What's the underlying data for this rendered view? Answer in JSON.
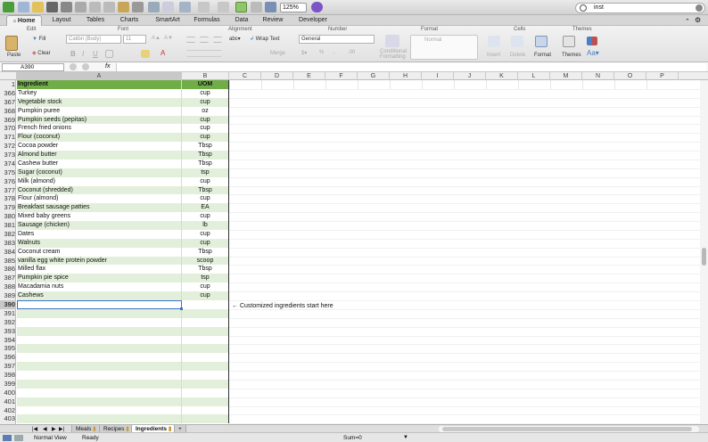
{
  "toolbar": {
    "zoom": "125%",
    "search_value": "inst"
  },
  "ribbon_tabs": [
    "Home",
    "Layout",
    "Tables",
    "Charts",
    "SmartArt",
    "Formulas",
    "Data",
    "Review",
    "Developer"
  ],
  "ribbon": {
    "groups": {
      "edit": "Edit",
      "font": "Font",
      "alignment": "Alignment",
      "number": "Number",
      "format": "Format",
      "cells": "Cells",
      "themes": "Themes"
    },
    "paste": "Paste",
    "fill": "Fill",
    "clear": "Clear",
    "font_name": "Calibri (Body)",
    "font_size": "11",
    "wrap_text": "Wrap Text",
    "merge": "Merge",
    "number_format": "General",
    "conditional_formatting": "Conditional Formatting",
    "style_normal": "Normal",
    "insert": "Insert",
    "delete": "Delete",
    "format_btn": "Format",
    "themes_btn": "Themes"
  },
  "formula_bar": {
    "cell_ref": "A390",
    "fx": "fx",
    "content": ""
  },
  "columns": [
    "A",
    "B",
    "C",
    "D",
    "E",
    "F",
    "G",
    "H",
    "I",
    "J",
    "K",
    "L",
    "M",
    "N",
    "O",
    "P"
  ],
  "header_row": {
    "num": "1",
    "ingredient": "Ingredient",
    "uom": "UOM"
  },
  "rows": [
    {
      "num": "366",
      "ingredient": "Turkey",
      "uom": "cup"
    },
    {
      "num": "367",
      "ingredient": "Vegetable stock",
      "uom": "cup"
    },
    {
      "num": "368",
      "ingredient": "Pumpkin puree",
      "uom": "oz"
    },
    {
      "num": "369",
      "ingredient": "Pumpkin seeds (pepitas)",
      "uom": "cup"
    },
    {
      "num": "370",
      "ingredient": "French fried onions",
      "uom": "cup"
    },
    {
      "num": "371",
      "ingredient": "Flour (coconut)",
      "uom": "cup"
    },
    {
      "num": "372",
      "ingredient": "Cocoa powder",
      "uom": "Tbsp"
    },
    {
      "num": "373",
      "ingredient": "Almond butter",
      "uom": "Tbsp"
    },
    {
      "num": "374",
      "ingredient": "Cashew butter",
      "uom": "Tbsp"
    },
    {
      "num": "375",
      "ingredient": "Sugar (coconut)",
      "uom": "tsp"
    },
    {
      "num": "376",
      "ingredient": "Milk (almond)",
      "uom": "cup"
    },
    {
      "num": "377",
      "ingredient": "Coconut (shredded)",
      "uom": "Tbsp"
    },
    {
      "num": "378",
      "ingredient": "Flour (almond)",
      "uom": "cup"
    },
    {
      "num": "379",
      "ingredient": "Breakfast sausage patties",
      "uom": "EA"
    },
    {
      "num": "380",
      "ingredient": "Mixed baby greens",
      "uom": "cup"
    },
    {
      "num": "381",
      "ingredient": "Sausage (chicken)",
      "uom": "lb"
    },
    {
      "num": "382",
      "ingredient": "Dates",
      "uom": "cup"
    },
    {
      "num": "383",
      "ingredient": "Walnuts",
      "uom": "cup"
    },
    {
      "num": "384",
      "ingredient": "Coconut cream",
      "uom": "Tbsp"
    },
    {
      "num": "385",
      "ingredient": "vanilla egg white protein powder",
      "uom": "scoop"
    },
    {
      "num": "386",
      "ingredient": "Milled flax",
      "uom": "Tbsp"
    },
    {
      "num": "387",
      "ingredient": "Pumpkin pie spice",
      "uom": "tsp"
    },
    {
      "num": "388",
      "ingredient": "Macadamia nuts",
      "uom": "cup"
    },
    {
      "num": "389",
      "ingredient": "Cashews",
      "uom": "cup"
    },
    {
      "num": "390",
      "ingredient": "",
      "uom": ""
    },
    {
      "num": "391",
      "ingredient": "",
      "uom": ""
    },
    {
      "num": "392",
      "ingredient": "",
      "uom": ""
    },
    {
      "num": "393",
      "ingredient": "",
      "uom": ""
    },
    {
      "num": "394",
      "ingredient": "",
      "uom": ""
    },
    {
      "num": "395",
      "ingredient": "",
      "uom": ""
    },
    {
      "num": "396",
      "ingredient": "",
      "uom": ""
    },
    {
      "num": "397",
      "ingredient": "",
      "uom": ""
    },
    {
      "num": "398",
      "ingredient": "",
      "uom": ""
    },
    {
      "num": "399",
      "ingredient": "",
      "uom": ""
    },
    {
      "num": "400",
      "ingredient": "",
      "uom": ""
    },
    {
      "num": "401",
      "ingredient": "",
      "uom": ""
    },
    {
      "num": "402",
      "ingredient": "",
      "uom": ""
    },
    {
      "num": "403",
      "ingredient": "",
      "uom": ""
    }
  ],
  "annotation": "← Customized ingredients start here",
  "sheet_tabs": [
    "Meals",
    "Recipes",
    "Ingredients"
  ],
  "active_sheet": "Ingredients",
  "status": {
    "view": "Normal View",
    "state": "Ready",
    "sum": "Sum=0"
  },
  "colors": {
    "header_green": "#70ad47",
    "band_green": "#e2efda",
    "accent": "#3a74c8"
  }
}
